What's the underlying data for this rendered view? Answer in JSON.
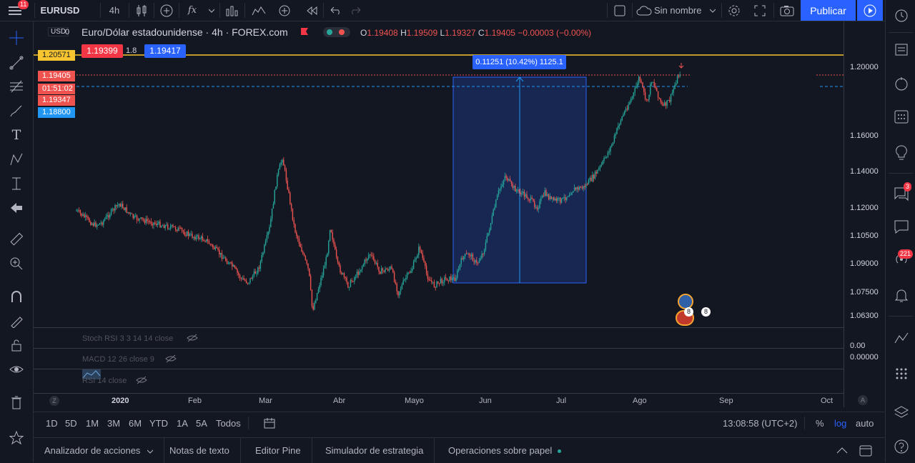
{
  "topbar": {
    "symbol": "EURUSD",
    "interval": "4h",
    "indicator_fx": "fx",
    "layout_name": "Sin nombre",
    "publish": "Publicar",
    "menu_badge": "11"
  },
  "legend": {
    "title": "Euro/Dólar estadounidense · 4h · FOREX.com",
    "o_label": "O",
    "o_value": "1.19408",
    "h_label": "H",
    "h_value": "1.19509",
    "l_label": "L",
    "l_value": "1.19327",
    "c_label": "C",
    "c_value": "1.19405",
    "change": "−0.00003 (−0.00%)",
    "usd_label": "USD",
    "usd_zero": "0"
  },
  "trade": {
    "sell_price": "1.19399",
    "spread": "1.8",
    "buy_price": "1.19417"
  },
  "measure": {
    "label": "0.11251 (10.42%) 1125.1"
  },
  "price_labels": {
    "yellow": "1.20571",
    "last": "1.19405",
    "countdown": "01:51:02",
    "low": "1.19347",
    "blue": "1.18800"
  },
  "price_ticks": [
    "1.20000",
    "1.16000",
    "1.14000",
    "1.12000",
    "1.10500",
    "1.09000",
    "1.07500",
    "1.06300"
  ],
  "time_ticks": [
    "2020",
    "Feb",
    "Mar",
    "Abr",
    "Mayo",
    "Jun",
    "Jul",
    "Ago",
    "Sep",
    "Oct"
  ],
  "panes": {
    "stoch": "Stoch RSI 3 3 14 14 close",
    "stoch_val": "0.00",
    "macd": "MACD 12 26 close 9",
    "macd_val": "0.00000",
    "rsi": "RSI 14 close"
  },
  "events": {
    "count_a": "8",
    "count_b": "8"
  },
  "range": {
    "buttons": [
      "1D",
      "5D",
      "1M",
      "3M",
      "6M",
      "YTD",
      "1A",
      "5A",
      "Todos"
    ],
    "time": "13:08:58 (UTC+2)",
    "percent": "%",
    "log": "log",
    "auto": "auto",
    "z_btn": "Z",
    "a_btn": "A"
  },
  "bottom": {
    "tabs": [
      "Analizador de acciones",
      "Notas de texto",
      "Editor Pine",
      "Simulador de estrategia",
      "Operaciones sobre papel"
    ]
  },
  "right": {
    "chat_badge": "3",
    "stream_badge": "221"
  },
  "colors": {
    "up": "#26a69a",
    "down": "#ef5350",
    "accent": "#2962ff",
    "yellow": "#f7c530",
    "bg": "#131722"
  }
}
